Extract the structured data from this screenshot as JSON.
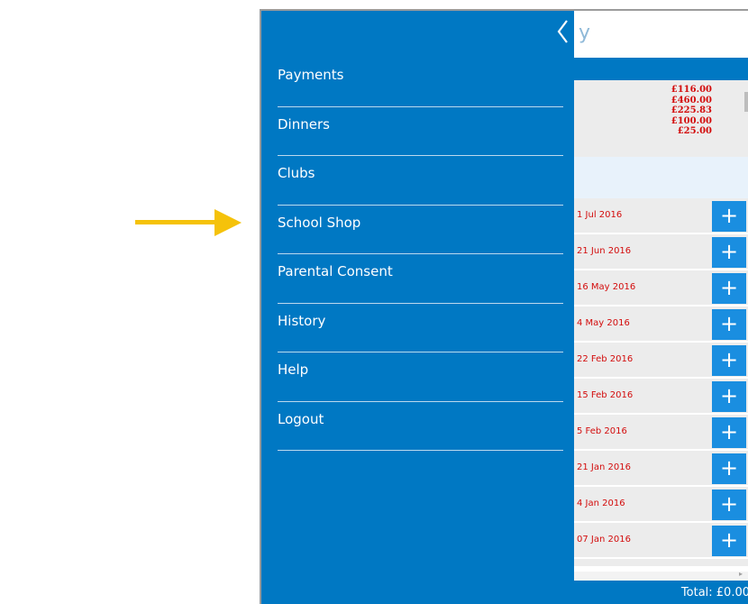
{
  "drawer": {
    "items": [
      {
        "label": "Payments"
      },
      {
        "label": "Dinners"
      },
      {
        "label": "Clubs"
      },
      {
        "label": "School Shop"
      },
      {
        "label": "Parental Consent"
      },
      {
        "label": "History"
      },
      {
        "label": "Help"
      },
      {
        "label": "Logout"
      }
    ]
  },
  "background": {
    "header_fragment": "y",
    "amounts": [
      "£116.00",
      "£460.00",
      "£225.83",
      "£100.00",
      "£25.00"
    ],
    "rows": [
      {
        "date": "1 Jul 2016"
      },
      {
        "date": "21 Jun 2016"
      },
      {
        "date": "16 May 2016"
      },
      {
        "date": "4 May 2016"
      },
      {
        "date": "22 Feb 2016"
      },
      {
        "date": "15 Feb 2016"
      },
      {
        "date": "5 Feb 2016"
      },
      {
        "date": "21 Jan 2016"
      },
      {
        "date": "4 Jan 2016"
      },
      {
        "date": "07 Jan 2016"
      }
    ],
    "add_symbol": "+",
    "total": "Total: £0.00"
  },
  "colors": {
    "brand_blue": "#0078c3",
    "button_blue": "#1a8ee0",
    "amount_red": "#d30c0c",
    "arrow_yellow": "#f5c20a"
  }
}
